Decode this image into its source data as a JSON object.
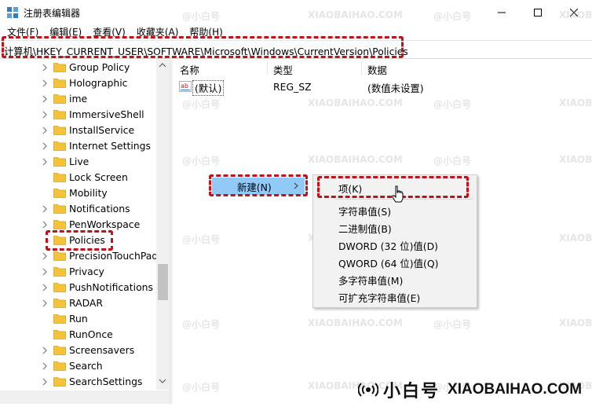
{
  "window": {
    "title": "注册表编辑器"
  },
  "menu": [
    "文件(F)",
    "编辑(E)",
    "查看(V)",
    "收藏夹(A)",
    "帮助(H)"
  ],
  "address": "计算机\\HKEY_CURRENT_USER\\SOFTWARE\\Microsoft\\Windows\\CurrentVersion\\Policies",
  "tree": {
    "items": [
      {
        "label": "Group Policy",
        "expandable": true
      },
      {
        "label": "Holographic",
        "expandable": true
      },
      {
        "label": "ime",
        "expandable": true
      },
      {
        "label": "ImmersiveShell",
        "expandable": true
      },
      {
        "label": "InstallService",
        "expandable": true
      },
      {
        "label": "Internet Settings",
        "expandable": true
      },
      {
        "label": "Live",
        "expandable": true
      },
      {
        "label": "Lock Screen",
        "expandable": false
      },
      {
        "label": "Mobility",
        "expandable": false
      },
      {
        "label": "Notifications",
        "expandable": true
      },
      {
        "label": "PenWorkspace",
        "expandable": true
      },
      {
        "label": "Policies",
        "expandable": false,
        "selected": true
      },
      {
        "label": "PrecisionTouchPad",
        "expandable": true
      },
      {
        "label": "Privacy",
        "expandable": true
      },
      {
        "label": "PushNotifications",
        "expandable": true
      },
      {
        "label": "RADAR",
        "expandable": true
      },
      {
        "label": "Run",
        "expandable": false
      },
      {
        "label": "RunOnce",
        "expandable": false
      },
      {
        "label": "Screensavers",
        "expandable": true
      },
      {
        "label": "Search",
        "expandable": true
      },
      {
        "label": "SearchSettings",
        "expandable": true
      }
    ]
  },
  "values": {
    "headers": {
      "name": "名称",
      "type": "类型",
      "data": "数据"
    },
    "rows": [
      {
        "name": "(默认)",
        "type": "REG_SZ",
        "data": "(数值未设置)"
      }
    ]
  },
  "context_menu": {
    "new_label": "新建(N)",
    "submenu": [
      "项(K)",
      "字符串值(S)",
      "二进制值(B)",
      "DWORD (32 位)值(D)",
      "QWORD (64 位)值(Q)",
      "多字符串值(M)",
      "可扩充字符串值(E)"
    ]
  },
  "watermark": {
    "cn": "小白号",
    "en": "XIAOBAIHAO.COM",
    "tile_cn": "@小白号",
    "tile_en": "XIAOBAIHAO.COM"
  },
  "colors": {
    "highlight_border": "#c0121a",
    "menu_hover": "#91c9f7",
    "folder": "#f5c33b"
  }
}
